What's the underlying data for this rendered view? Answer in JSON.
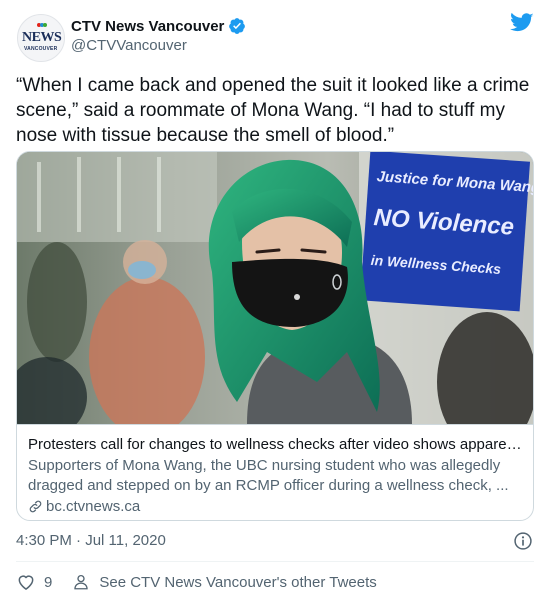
{
  "author": {
    "display_name": "CTV News Vancouver",
    "handle": "@CTVVancouver",
    "avatar_logo_text": "NEWS",
    "avatar_logo_subtext": "VANCOUVER",
    "verified_icon": "verified-badge-icon"
  },
  "tweet": {
    "text": "“When I came back and opened the suit it looked like a crime scene,” said a roommate of Mona Wang. “I had to stuff my nose with tissue because the smell of blood.”"
  },
  "card": {
    "title": "Protesters call for changes to wellness checks after video shows apparent...",
    "description": "Supporters of Mona Wang, the UBC nursing student who was allegedly dragged and stepped on by an RCMP officer during a wellness check, ...",
    "domain": "bc.ctvnews.ca",
    "image_sign_text": [
      "Justice for Mona Wang",
      "NO Violence",
      "in Wellness Checks"
    ]
  },
  "meta": {
    "timestamp": "4:30 PM · Jul 11, 2020"
  },
  "actions": {
    "like_count": "9",
    "see_more": "See CTV News Vancouver's other Tweets"
  },
  "colors": {
    "twitter_blue": "#1d9bf0",
    "text_primary": "#0f1419",
    "text_secondary": "#536471",
    "border": "#cfd9de"
  }
}
